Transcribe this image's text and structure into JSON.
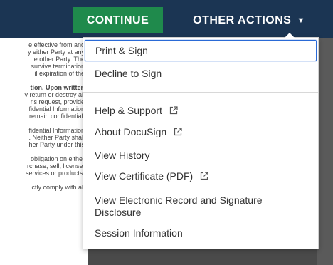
{
  "header": {
    "continue_label": "CONTINUE",
    "other_actions_label": "OTHER ACTIONS",
    "caret": "▼"
  },
  "document": {
    "lines": [
      [
        "e effective from and",
        "y either Party at any",
        "e other Party. The",
        "survive termination",
        "il expiration of the"
      ],
      [
        "tion. Upon written",
        "v return or destroy all",
        "r's request, provide",
        "fidential Information",
        "remain confidential,"
      ],
      [
        "fidential Information",
        ". Neither Party shall",
        "her Party under this"
      ],
      [
        "obligation on either",
        "rchase, sell, license,",
        "services or products."
      ],
      [
        "ctly comply with all"
      ]
    ]
  },
  "menu": {
    "items": [
      {
        "label": "Print & Sign",
        "external": false
      },
      {
        "label": "Decline to Sign",
        "external": false
      },
      {
        "label": "Help & Support",
        "external": true
      },
      {
        "label": "About DocuSign",
        "external": true
      },
      {
        "label": "View History",
        "external": false
      },
      {
        "label": "View Certificate (PDF)",
        "external": true
      },
      {
        "label": "View Electronic Record and Signature Disclosure",
        "external": false
      },
      {
        "label": "Session Information",
        "external": false
      }
    ]
  },
  "colors": {
    "topbar": "#1b3553",
    "continue": "#1f8a4c",
    "focus": "#2a6ad6"
  },
  "icons": {
    "external": "external-link-icon"
  }
}
